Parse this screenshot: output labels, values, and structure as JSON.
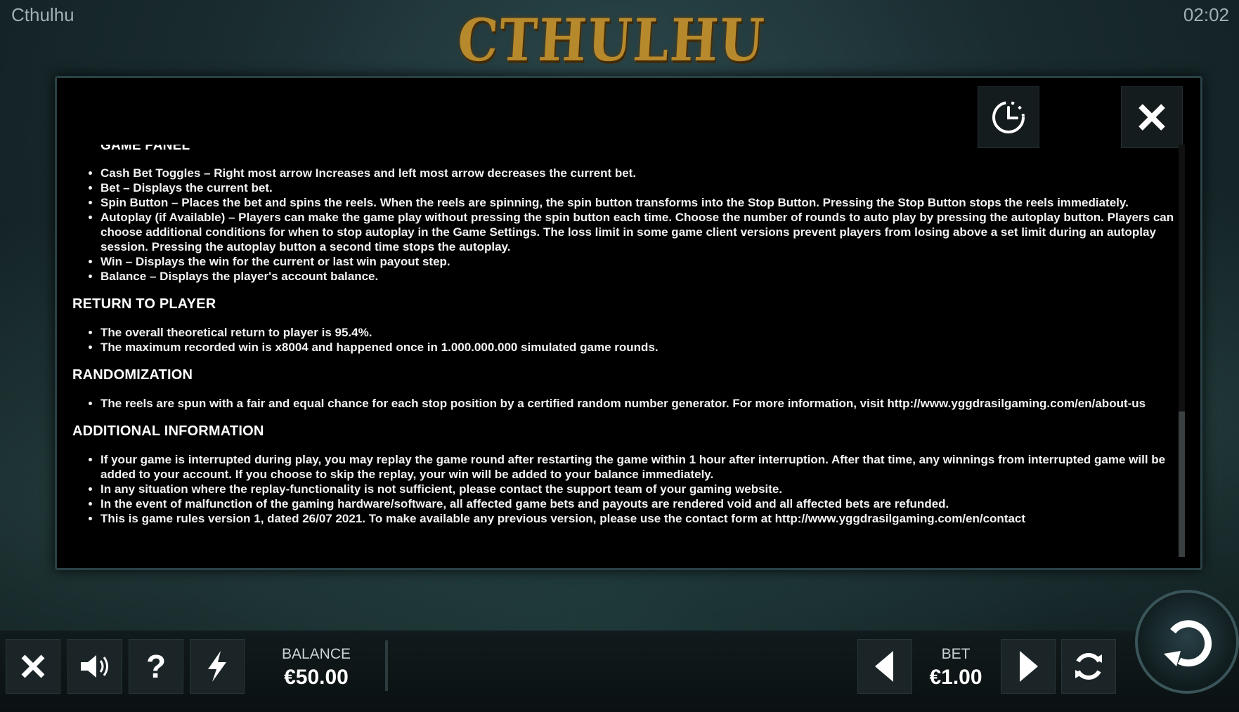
{
  "app": {
    "title": "Cthulhu",
    "clock": "02:02",
    "logo_text": "CTHULHU"
  },
  "modal": {
    "partial_heading": "GAME PANEL",
    "game_panel_items": [
      "Cash Bet Toggles – Right most arrow Increases and left most arrow decreases the current bet.",
      "Bet – Displays the current bet.",
      "Spin Button – Places the bet and spins the reels. When the reels are spinning, the spin button transforms into the Stop Button. Pressing the Stop Button stops the reels immediately.",
      "Autoplay (if Available) – Players can make the game play without pressing the spin button each time. Choose the number of rounds to auto play by pressing the autoplay button. Players can choose additional conditions for when to stop autoplay in the Game Settings. The loss limit in some game client versions prevent players from losing above a set limit during an autoplay session. Pressing the autoplay button a second time stops the autoplay.",
      "Win – Displays the win for the current or last win payout step.",
      "Balance – Displays the player's account balance."
    ],
    "rtp": {
      "heading": "RETURN TO PLAYER",
      "items": [
        "The overall theoretical return to player is 95.4%.",
        "The maximum recorded win is x8004 and happened once in 1.000.000.000 simulated game rounds."
      ]
    },
    "randomization": {
      "heading": "RANDOMIZATION",
      "items": [
        "The reels are spun with a fair and equal chance for each stop position by a certified random number generator. For more information, visit http://www.yggdrasilgaming.com/en/about-us"
      ]
    },
    "additional": {
      "heading": "ADDITIONAL INFORMATION",
      "items": [
        "If your game is interrupted during play, you may replay the game round after restarting the game within 1 hour after interruption. After that time, any winnings from interrupted game will be added to your account. If you choose to skip the replay, your win will be added to your balance immediately.",
        "In any situation where the replay-functionality is not sufficient, please contact the support team of your gaming website.",
        "In the event of malfunction of the gaming hardware/software, all affected game bets and payouts are rendered void and all affected bets are refunded.",
        "This is game rules version 1, dated 26/07 2021. To make available any previous version, please use the contact form at http://www.yggdrasilgaming.com/en/contact"
      ]
    }
  },
  "controls": {
    "balance_label": "BALANCE",
    "balance_value": "€50.00",
    "bet_label": "BET",
    "bet_value": "€1.00",
    "icons": [
      "close-icon",
      "speaker-icon",
      "question-icon",
      "lightning-icon",
      "arrow-left-icon",
      "arrow-right-icon",
      "autoplay-icon",
      "spin-icon"
    ]
  },
  "colors": {
    "logo": "#b7892d",
    "modal_bg": "#000000",
    "button_bg": "#1b2527"
  }
}
